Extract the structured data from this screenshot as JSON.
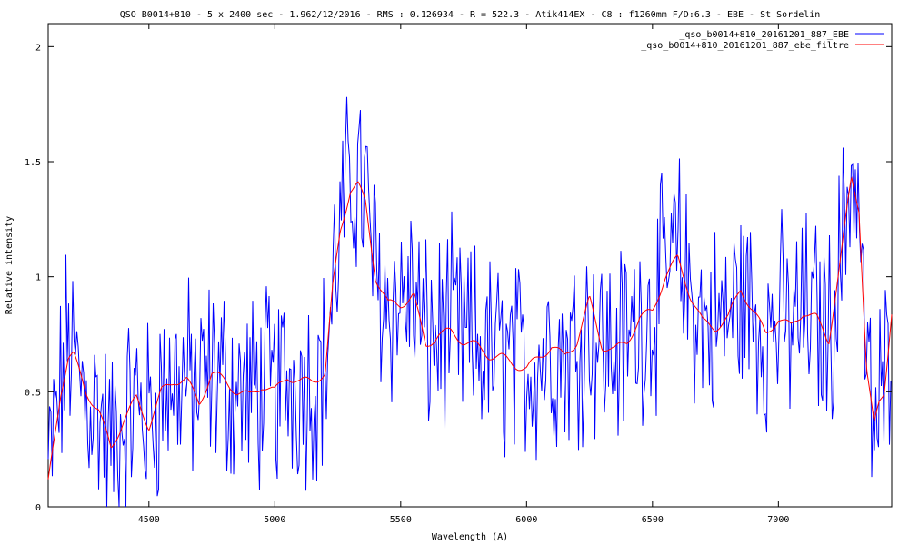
{
  "chart_data": {
    "type": "line",
    "title": "QSO B0014+810 - 5 x 2400 sec - 1.962/12/2016 - RMS : 0.126934 - R = 522.3 - Atik414EX - C8 : f1260mm F/D:6.3 - EBE - St Sordelin",
    "xlabel": "Wavelength (A)",
    "ylabel": "Relative intensity",
    "xlim": [
      4100,
      7450
    ],
    "ylim": [
      0,
      2.1
    ],
    "x_ticks": [
      4500,
      5000,
      5500,
      6000,
      6500,
      7000
    ],
    "x_tick_labels": [
      "4500",
      "5000",
      "5500",
      "6000",
      "6500",
      "7000"
    ],
    "y_ticks": [
      0,
      0.5,
      1,
      1.5,
      2
    ],
    "y_tick_labels": [
      "0",
      "0.5",
      "1",
      "1.5",
      "2"
    ],
    "grid": false,
    "legend_position": "top-right",
    "series": [
      {
        "name": "_qso_b0014+810_20161201_887_EBE",
        "color": "#0000ff",
        "style": "noisy",
        "x": [
          4100,
          4150,
          4180,
          4200,
          4250,
          4300,
          4350,
          4400,
          4450,
          4500,
          4550,
          4600,
          4650,
          4700,
          4750,
          4800,
          4850,
          4900,
          4950,
          5000,
          5050,
          5100,
          5150,
          5200,
          5230,
          5260,
          5300,
          5330,
          5360,
          5400,
          5450,
          5500,
          5550,
          5600,
          5650,
          5700,
          5750,
          5800,
          5850,
          5900,
          5950,
          6000,
          6050,
          6100,
          6150,
          6200,
          6250,
          6300,
          6350,
          6400,
          6450,
          6500,
          6550,
          6600,
          6650,
          6700,
          6750,
          6800,
          6850,
          6900,
          6950,
          7000,
          7050,
          7100,
          7150,
          7200,
          7250,
          7290,
          7320,
          7350,
          7380,
          7400,
          7420,
          7450
        ],
        "y": [
          0.15,
          0.5,
          0.75,
          0.62,
          0.48,
          0.42,
          0.25,
          0.38,
          0.45,
          0.38,
          0.5,
          0.55,
          0.55,
          0.5,
          0.58,
          0.55,
          0.5,
          0.48,
          0.52,
          0.5,
          0.56,
          0.54,
          0.55,
          0.6,
          0.95,
          1.2,
          1.4,
          1.45,
          1.35,
          1.0,
          0.88,
          0.9,
          0.92,
          0.72,
          0.75,
          0.78,
          0.72,
          0.7,
          0.66,
          0.65,
          0.62,
          0.62,
          0.65,
          0.7,
          0.65,
          0.72,
          0.8,
          0.7,
          0.68,
          0.72,
          0.82,
          0.85,
          1.0,
          1.1,
          0.92,
          0.8,
          0.78,
          0.82,
          0.92,
          0.85,
          0.75,
          0.82,
          0.78,
          0.85,
          0.82,
          0.75,
          1.1,
          1.5,
          1.3,
          0.6,
          0.3,
          0.45,
          0.5,
          0.85
        ]
      },
      {
        "name": "_qso_b0014+810_20161201_887_ebe_filtre",
        "color": "#ff0000",
        "style": "smooth",
        "x": [
          4100,
          4150,
          4180,
          4200,
          4250,
          4300,
          4350,
          4400,
          4450,
          4500,
          4550,
          4600,
          4650,
          4700,
          4750,
          4800,
          4850,
          4900,
          4950,
          5000,
          5050,
          5100,
          5150,
          5200,
          5230,
          5260,
          5300,
          5330,
          5360,
          5400,
          5450,
          5500,
          5550,
          5600,
          5650,
          5700,
          5750,
          5800,
          5850,
          5900,
          5950,
          6000,
          6050,
          6100,
          6150,
          6200,
          6250,
          6300,
          6350,
          6400,
          6450,
          6500,
          6550,
          6600,
          6650,
          6700,
          6750,
          6800,
          6850,
          6900,
          6950,
          7000,
          7050,
          7100,
          7150,
          7200,
          7250,
          7290,
          7320,
          7350,
          7380,
          7400,
          7420,
          7450
        ],
        "y": [
          0.1,
          0.5,
          0.65,
          0.66,
          0.5,
          0.42,
          0.25,
          0.38,
          0.47,
          0.35,
          0.5,
          0.55,
          0.55,
          0.45,
          0.58,
          0.55,
          0.5,
          0.48,
          0.53,
          0.5,
          0.57,
          0.54,
          0.55,
          0.58,
          0.95,
          1.2,
          1.38,
          1.4,
          1.32,
          1.0,
          0.88,
          0.88,
          0.92,
          0.7,
          0.75,
          0.76,
          0.72,
          0.7,
          0.66,
          0.65,
          0.62,
          0.6,
          0.65,
          0.7,
          0.65,
          0.72,
          0.9,
          0.7,
          0.68,
          0.72,
          0.82,
          0.85,
          1.0,
          1.08,
          0.92,
          0.8,
          0.78,
          0.82,
          0.95,
          0.85,
          0.75,
          0.82,
          0.78,
          0.85,
          0.82,
          0.72,
          1.1,
          1.43,
          1.3,
          0.6,
          0.35,
          0.45,
          0.5,
          0.85
        ]
      }
    ]
  }
}
